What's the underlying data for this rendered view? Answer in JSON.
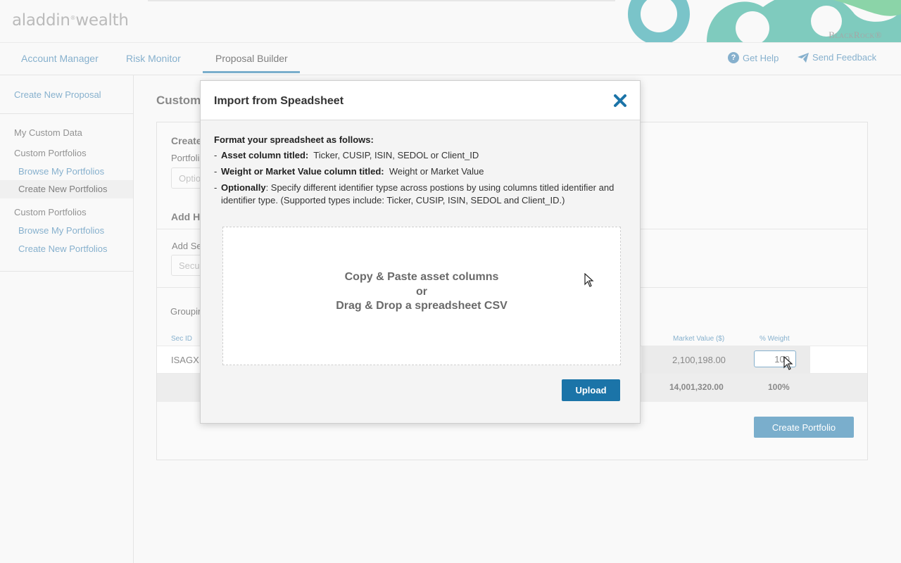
{
  "header": {
    "logo_main": "aladdin",
    "logo_mark": "®",
    "logo_sub": "wealth",
    "brand": "BlackRock®",
    "brand_colors": {
      "teal": "#1a9aa3",
      "green": "#2fb06f"
    }
  },
  "nav": {
    "tabs": [
      {
        "label": "Account Manager"
      },
      {
        "label": "Risk Monitor"
      },
      {
        "label": "Proposal Builder"
      }
    ],
    "active_tab": "Proposal Builder",
    "get_help": "Get Help",
    "send_feedback": "Send Feedback",
    "accent": "#1b74a8"
  },
  "sidebar": {
    "create_new_proposal": "Create New Proposal",
    "my_custom_data": "My Custom Data",
    "group1": {
      "title": "Custom Portfolios",
      "items": [
        {
          "label": "Browse My Portfolios"
        },
        {
          "label": "Create New Portfolios"
        }
      ],
      "active_item": "Create New Portfolios"
    },
    "group2": {
      "title": "Custom Portfolios",
      "items": [
        {
          "label": "Browse My Portfolios"
        },
        {
          "label": "Create New Portfolios"
        }
      ]
    }
  },
  "main": {
    "title_partial": "Custom",
    "section1_partial": "Create",
    "portfolio_label_partial": "Portfoli",
    "portfolio_placeholder_partial": "Optio",
    "add_holdings_partial": "Add Ho",
    "add_security_partial": "Add Se",
    "security_placeholder_partial": "Secur",
    "grouping_partial": "Groupin",
    "table": {
      "col_sec_id": "Sec ID",
      "col_market_value": "Market Value ($)",
      "col_weight": "% Weight",
      "row_sec_id": "ISAGX",
      "row_market_value": "2,100,198.00",
      "row_weight_value": "100",
      "total_market_value": "14,001,320.00",
      "total_weight": "100%"
    },
    "create_portfolio": "Create Portfolio"
  },
  "modal": {
    "title": "Import from Speadsheet",
    "instructions_title": "Format your spreadsheet as follows:",
    "line1_bold": "Asset column titled:",
    "line1_text": "Ticker, CUSIP, ISIN, SEDOL or Client_ID",
    "line2_bold": "Weight or Market Value column titled:",
    "line2_text": "Weight or Market Value",
    "line3_bold": "Optionally",
    "line3_text": ":  Specify different identifier typse across postions by using columns titled identifier and identifier type. (Supported types include: Ticker, CUSIP,  ISIN, SEDOL and Client_ID.)",
    "dash": "-",
    "drop_line1": "Copy & Paste asset columns",
    "drop_line2": "or",
    "drop_line3": "Drag & Drop a spreadsheet CSV",
    "upload": "Upload",
    "close_color": "#1b74a8"
  }
}
